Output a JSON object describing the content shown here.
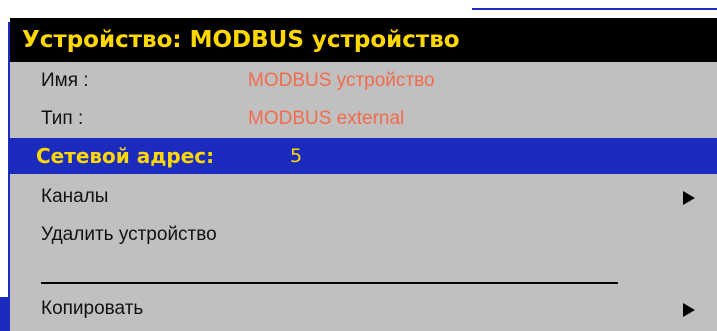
{
  "menu": {
    "title": "Устройство: MODBUS устройство",
    "name_label": "Имя :",
    "name_value": "MODBUS устройство",
    "type_label": "Тип :",
    "type_value": "MODBUS external",
    "address_label": "Сетевой адрес:",
    "address_value": "5",
    "channels_label": "Каналы",
    "delete_label": "Удалить устройство",
    "copy_label": "Копировать"
  },
  "icons": {
    "submenu": "submenu-arrow-icon"
  },
  "colors": {
    "title_background": "#000000",
    "title_text": "#ffd800",
    "menu_background": "#c0c0c0",
    "value_text": "#f26b4c",
    "highlight_background": "#1b2bbd",
    "highlight_text": "#ffd800"
  }
}
